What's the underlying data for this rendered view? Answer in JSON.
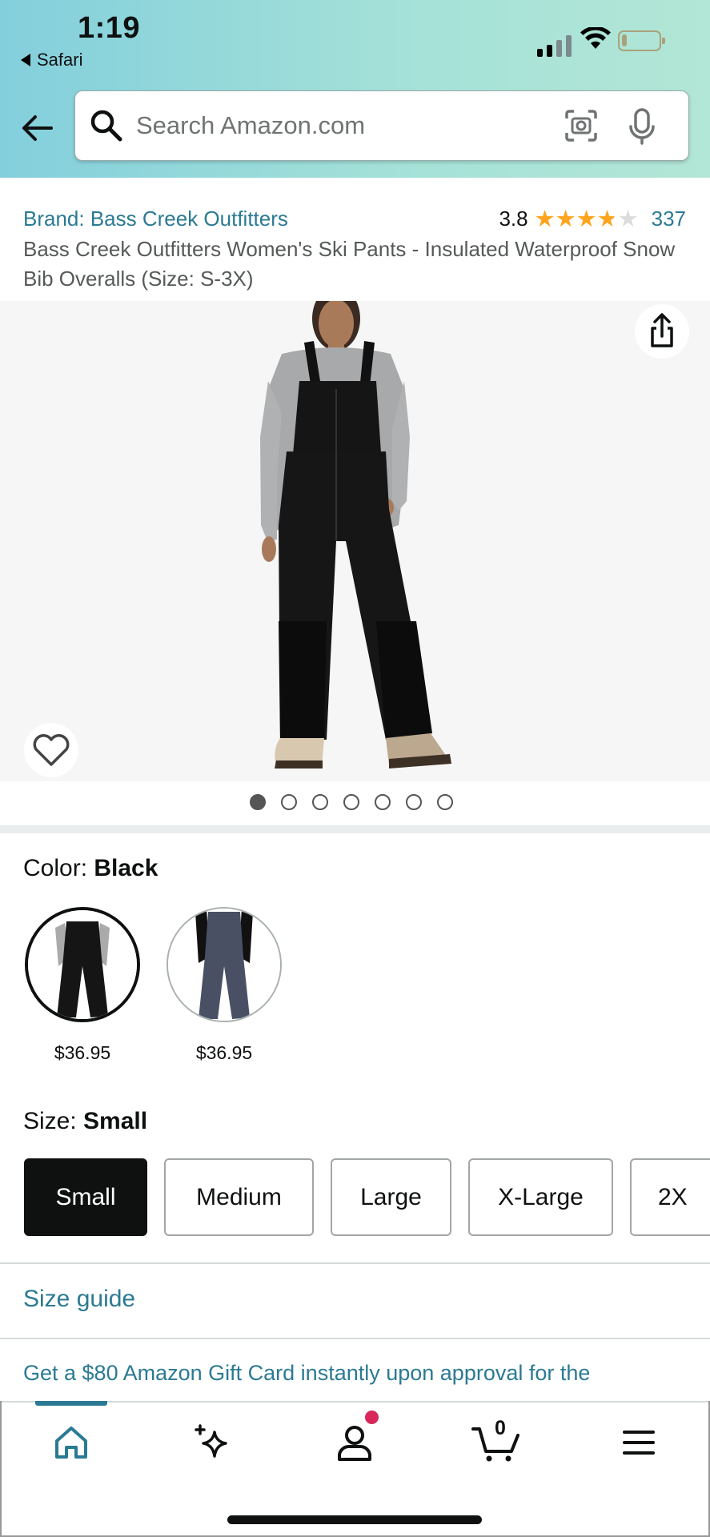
{
  "status_bar": {
    "time": "1:19",
    "back_app": "Safari"
  },
  "search": {
    "placeholder": "Search Amazon.com"
  },
  "product": {
    "brand": "Brand: Bass Creek Outfitters",
    "rating": "3.8",
    "rating_stars": 3.8,
    "review_count": "337",
    "title": "Bass Creek Outfitters Women's Ski Pants - Insulated Waterproof Snow Bib Overalls (Size: S-3X)"
  },
  "gallery": {
    "image_count": 7,
    "active_index": 0
  },
  "color": {
    "label": "Color: ",
    "selected": "Black",
    "options": [
      {
        "name": "Black",
        "price": "$36.95"
      },
      {
        "name": "Grey",
        "price": "$36.95"
      }
    ]
  },
  "size": {
    "label": "Size: ",
    "selected": "Small",
    "options": [
      "Small",
      "Medium",
      "Large",
      "X-Large",
      "2X"
    ]
  },
  "links": {
    "size_guide": "Size guide",
    "promo": "Get a $80 Amazon Gift Card instantly upon approval for the"
  },
  "tabbar": {
    "items": [
      "home",
      "ai-assistant",
      "account",
      "cart",
      "menu"
    ],
    "cart_count": "0"
  },
  "colors": {
    "link": "#2b7a93",
    "star": "#ffa41c",
    "text": "#0f1111",
    "badge": "#d8285a"
  }
}
